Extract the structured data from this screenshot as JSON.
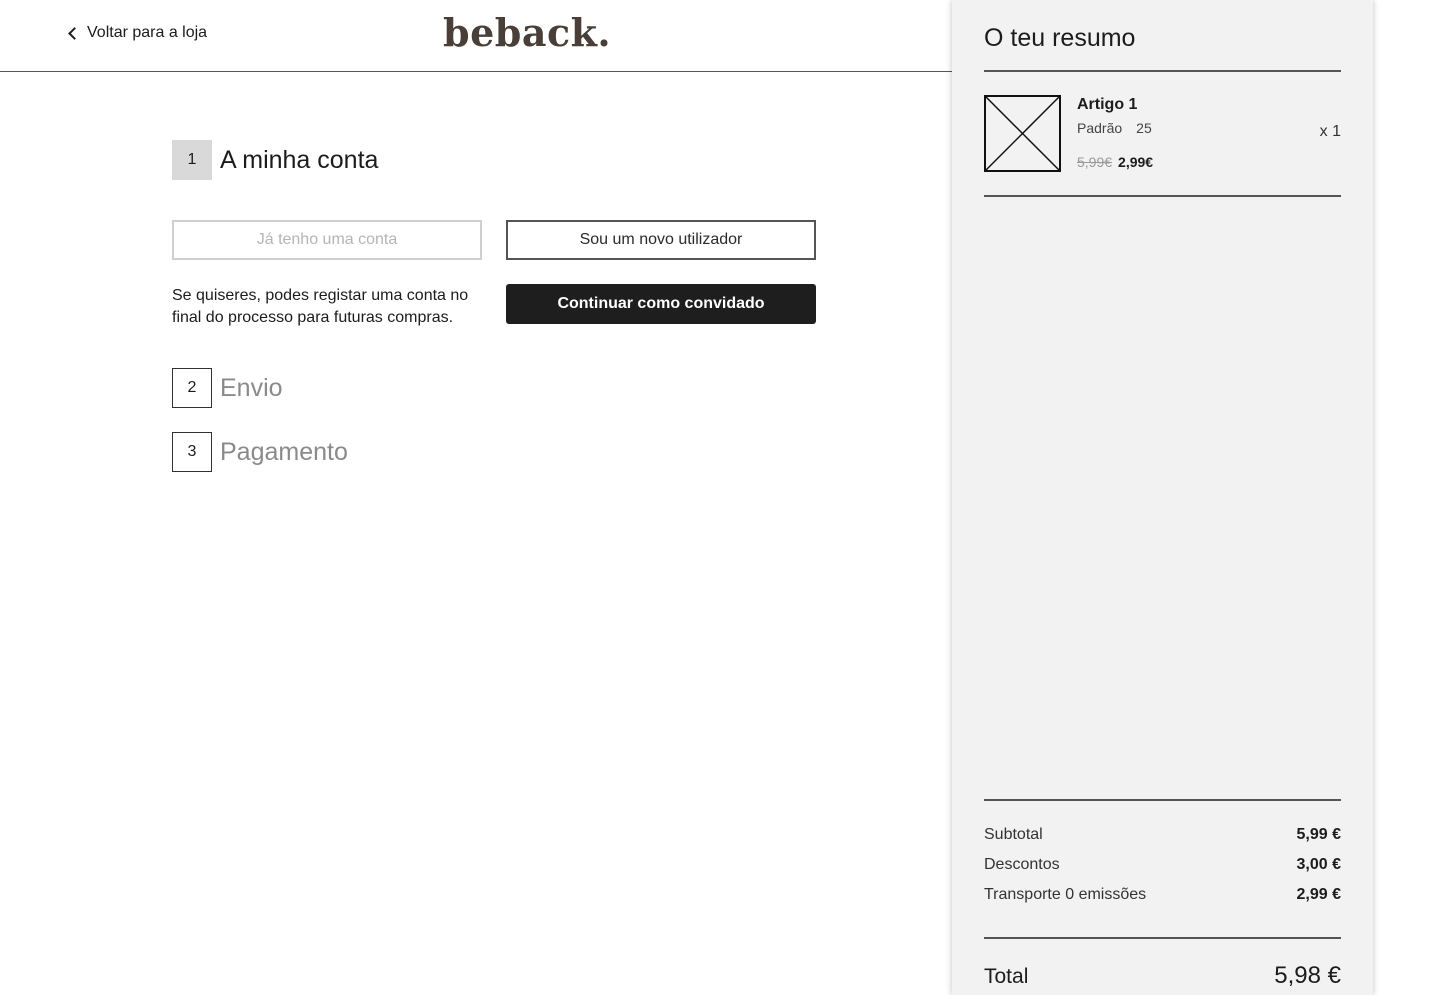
{
  "header": {
    "back_label": "Voltar para a loja",
    "logo": "beback."
  },
  "steps": [
    {
      "number": "1",
      "title": "A minha conta",
      "state": "active"
    },
    {
      "number": "2",
      "title": "Envio",
      "state": "inactive"
    },
    {
      "number": "3",
      "title": "Pagamento",
      "state": "inactive"
    }
  ],
  "account": {
    "existing_account_label": "Já tenho uma conta",
    "new_user_label": "Sou um novo utilizador",
    "note": "Se quiseres, podes registar uma conta no final do processo para futuras compras.",
    "guest_label": "Continuar como convidado"
  },
  "summary": {
    "title": "O teu resumo",
    "items": [
      {
        "name": "Artigo 1",
        "variant": "Padrão",
        "size": "25",
        "old_price": "5,99€",
        "price": "2,99€",
        "quantity": "x 1",
        "image_icon": "image-placeholder-icon"
      }
    ],
    "subtotal_label": "Subtotal",
    "subtotal_value": "5,99 €",
    "discounts_label": "Descontos",
    "discounts_value": "3,00 €",
    "shipping_label": "Transporte 0 emissões",
    "shipping_value": "2,99 €",
    "total_label": "Total",
    "total_value": "5,98 €"
  },
  "colors": {
    "logo": "#4a3f37",
    "dark_button": "#1e1e1e",
    "summary_bg": "#f2f2f2",
    "active_step_bg": "#d9d9d9"
  }
}
